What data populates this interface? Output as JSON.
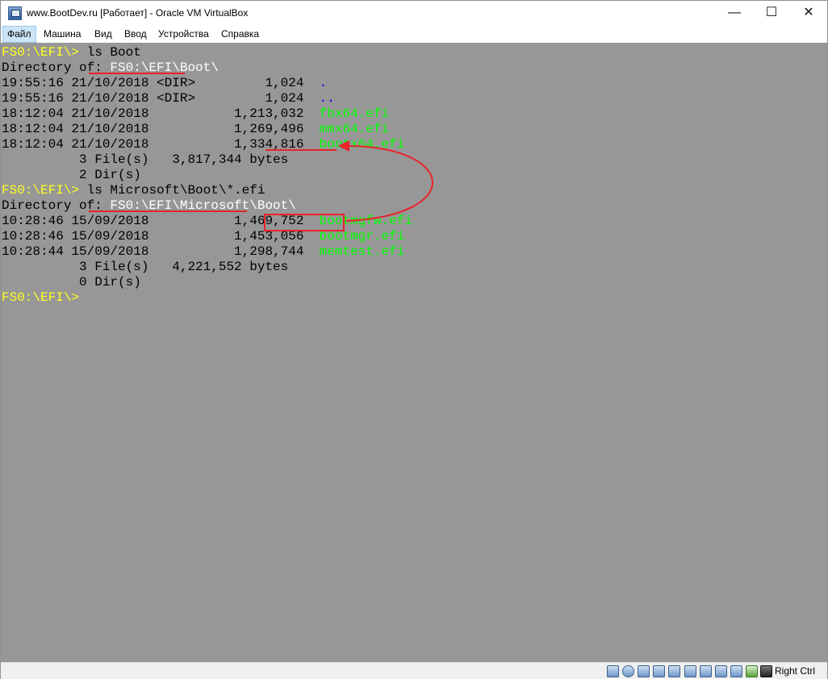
{
  "window": {
    "title": "www.BootDev.ru [Работает] - Oracle VM VirtualBox",
    "controls": {
      "minimize": "—",
      "maximize": "☐",
      "close": "✕"
    }
  },
  "menu": {
    "items": [
      "Файл",
      "Машина",
      "Вид",
      "Ввод",
      "Устройства",
      "Справка"
    ],
    "active_index": 0
  },
  "terminal": {
    "bg_color": "#979797",
    "prompt_color": "#ffff22",
    "file_color": "#00ff00",
    "dir_color": "#0000ee",
    "lines": [
      [
        {
          "t": "FS0:\\EFI\\> ",
          "c": "yl"
        },
        {
          "t": "ls Boot",
          "c": "bk"
        }
      ],
      [
        {
          "t": "Directory of: ",
          "c": "bk"
        },
        {
          "t": "FS0:\\EFI\\Boot\\",
          "c": "wh"
        }
      ],
      [
        {
          "t": "19:55:16 21/10/2018 <DIR>         1,024  ",
          "c": "bk"
        },
        {
          "t": ".",
          "c": "bl"
        }
      ],
      [
        {
          "t": "19:55:16 21/10/2018 <DIR>         1,024  ",
          "c": "bk"
        },
        {
          "t": "..",
          "c": "bl"
        }
      ],
      [
        {
          "t": "18:12:04 21/10/2018           1,213,032  ",
          "c": "bk"
        },
        {
          "t": "fbx64.efi",
          "c": "gr"
        }
      ],
      [
        {
          "t": "18:12:04 21/10/2018           1,269,496  ",
          "c": "bk"
        },
        {
          "t": "mmx64.efi",
          "c": "gr"
        }
      ],
      [
        {
          "t": "18:12:04 21/10/2018           1,334,816  ",
          "c": "bk"
        },
        {
          "t": "bootx64.efi",
          "c": "gr"
        }
      ],
      [
        {
          "t": "          3 File(s)   3,817,344 bytes",
          "c": "bk"
        }
      ],
      [
        {
          "t": "          2 Dir(s)",
          "c": "bk"
        }
      ],
      [
        {
          "t": "FS0:\\EFI\\> ",
          "c": "yl"
        },
        {
          "t": "ls Microsoft\\Boot\\*.efi",
          "c": "bk"
        }
      ],
      [
        {
          "t": "Directory of: ",
          "c": "bk"
        },
        {
          "t": "FS0:\\EFI\\Microsoft\\Boot\\",
          "c": "wh"
        }
      ],
      [
        {
          "t": "10:28:46 15/09/2018           1,469,752  ",
          "c": "bk"
        },
        {
          "t": "bootmgfw.efi",
          "c": "gr"
        }
      ],
      [
        {
          "t": "10:28:46 15/09/2018           1,453,056  ",
          "c": "bk"
        },
        {
          "t": "bootmgr.efi",
          "c": "gr"
        }
      ],
      [
        {
          "t": "10:28:44 15/09/2018           1,298,744  ",
          "c": "bk"
        },
        {
          "t": "memtest.efi",
          "c": "gr"
        }
      ],
      [
        {
          "t": "          3 File(s)   4,221,552 bytes",
          "c": "bk"
        }
      ],
      [
        {
          "t": "          0 Dir(s)",
          "c": "bk"
        }
      ],
      [
        {
          "t": "FS0:\\EFI\\>",
          "c": "yl"
        }
      ]
    ]
  },
  "annotations": {
    "color": "#e8232a",
    "underlined": [
      "FS0:\\EFI\\Boot\\",
      "FS0:\\EFI\\Microsoft\\Boot\\",
      "bootx64.efi"
    ],
    "boxed": "bootmgfw.efi",
    "arrow": {
      "from": "bootmgfw.efi",
      "to": "bootx64.efi"
    }
  },
  "statusbar": {
    "icons": [
      "hard-disk-icon",
      "optical-drive-icon",
      "audio-icon",
      "network-icon",
      "usb-icon",
      "shared-folders-icon",
      "display-icon",
      "video-capture-icon",
      "cpu-virtualization-icon",
      "green-status-icon",
      "mouse-integration-icon"
    ],
    "host_key": "Right Ctrl"
  }
}
